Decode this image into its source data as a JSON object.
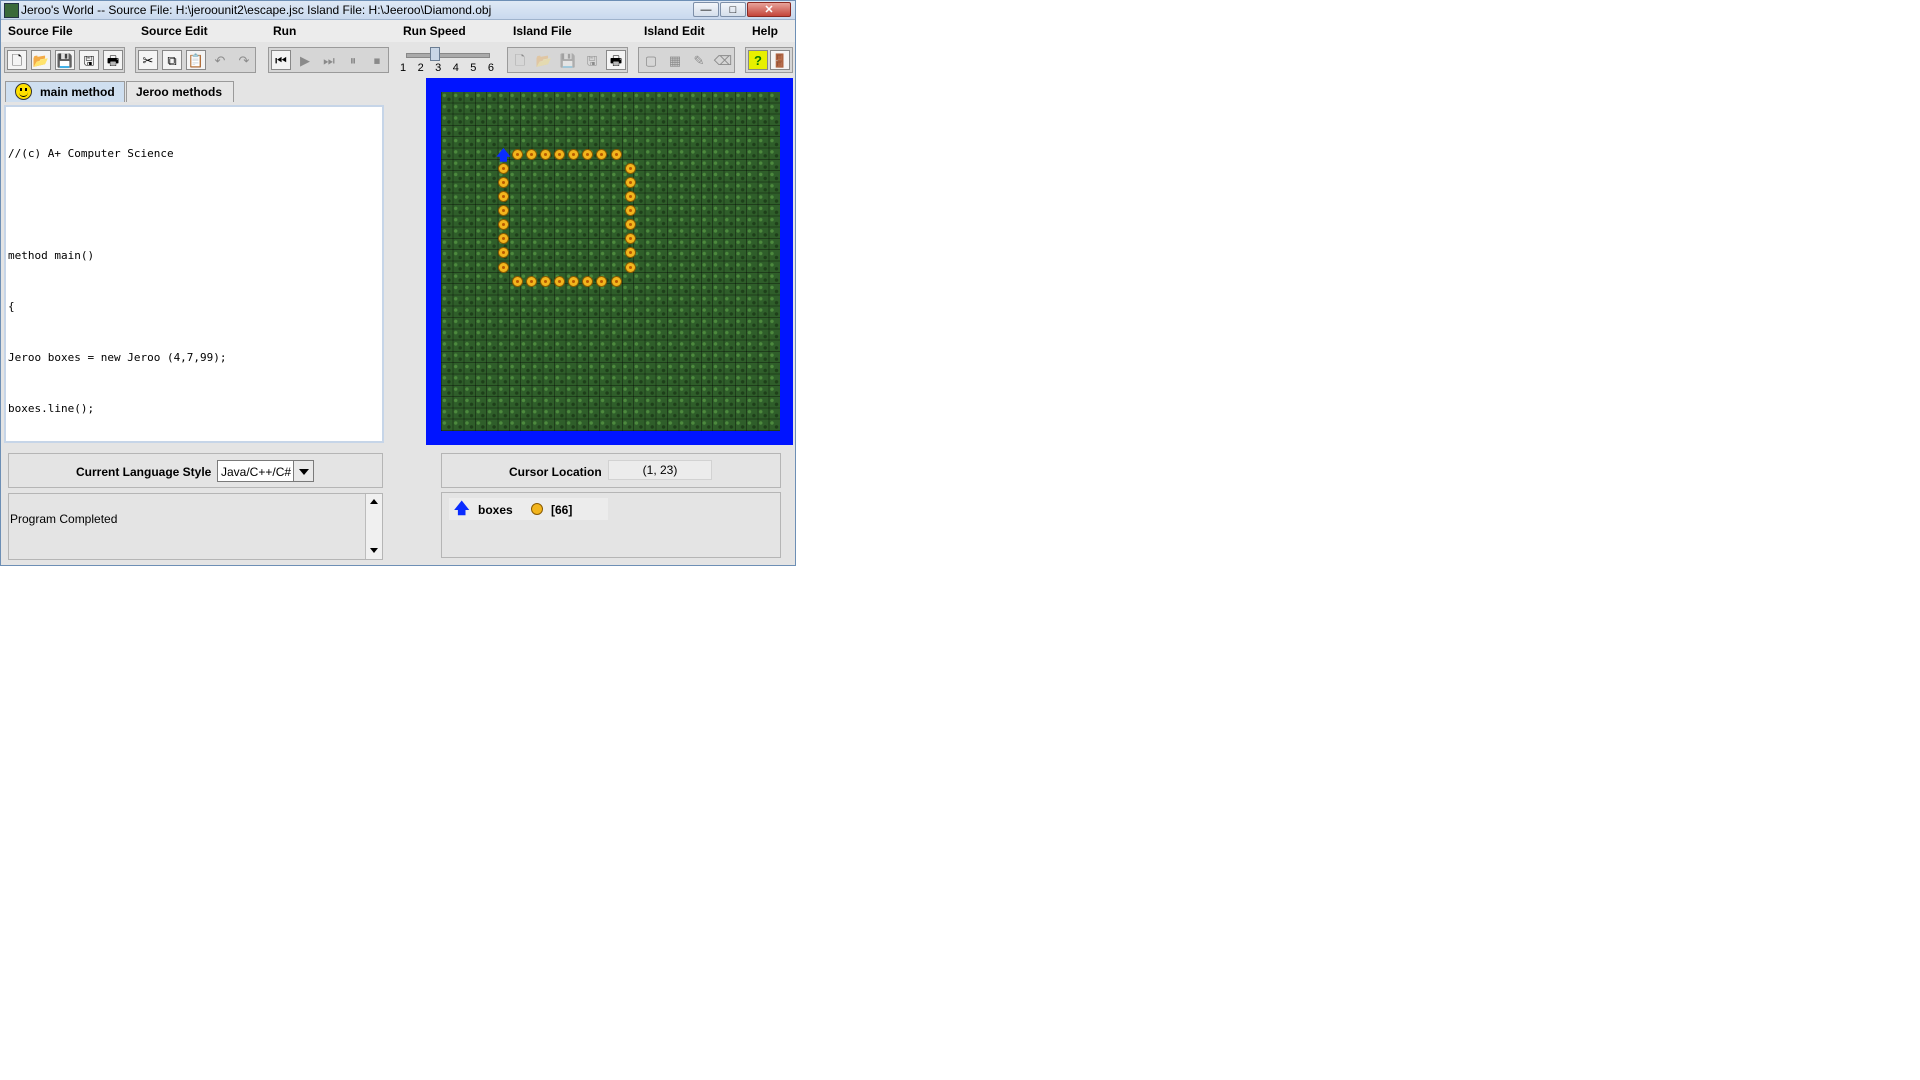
{
  "window": {
    "title": "Jeroo's World -- Source File: H:\\jeroounit2\\escape.jsc    Island File: H:\\Jeeroo\\Diamond.obj",
    "controls": {
      "minimize": "—",
      "maximize": "□",
      "close": "✕"
    }
  },
  "menubar": [
    "Source File",
    "Source Edit",
    "Run",
    "Run Speed",
    "Island File",
    "Island Edit",
    "Help"
  ],
  "toolbar": {
    "source_buttons": [
      "new-file-icon",
      "open-file-icon",
      "save-icon",
      "save-as-icon",
      "print-icon"
    ],
    "edit_buttons": [
      "cut-icon",
      "copy-icon",
      "paste-icon",
      "undo-icon",
      "redo-icon"
    ],
    "run_buttons": [
      "reset-icon",
      "run-icon",
      "step-icon",
      "pause-icon",
      "stop-icon"
    ],
    "island_buttons": [
      "new-island-icon",
      "open-island-icon",
      "save-island-icon",
      "save-island-as-icon",
      "print-island-icon"
    ],
    "island_edit_buttons": [
      "clear-island-icon",
      "grid-icon",
      "edit-icon",
      "erase-icon"
    ],
    "help_buttons": [
      "help-icon",
      "exit-icon"
    ],
    "run_speed": {
      "labels": [
        "1",
        "2",
        "3",
        "4",
        "5",
        "6"
      ],
      "value": 3
    }
  },
  "tabs": [
    {
      "label": "main method",
      "active": true
    },
    {
      "label": "Jeroo methods",
      "active": false
    }
  ],
  "editor": {
    "lines": [
      "//(c) A+ Computer Science",
      "",
      "method main()",
      "{",
      "Jeroo boxes = new Jeroo (4,7,99);",
      "boxes.line();",
      "}"
    ],
    "highlight_line": 7
  },
  "language": {
    "label": "Current Language Style",
    "value": "Java/C++/C#"
  },
  "status": {
    "message": "Program Completed"
  },
  "cursor": {
    "label": "Cursor Location",
    "value": "(1, 23)"
  },
  "jeroo": {
    "name": "boxes",
    "flowers": "[66]",
    "direction": "north"
  },
  "island": {
    "cols": 24,
    "rows": 24,
    "jeroo_cell": [
      4,
      4
    ],
    "flowers_top": {
      "row": 4,
      "cols": [
        5,
        6,
        7,
        8,
        9,
        10,
        11,
        12
      ]
    },
    "flowers_left": {
      "col": 4,
      "rows": [
        5,
        6,
        7,
        8,
        9,
        10,
        11,
        12
      ]
    },
    "flowers_right": {
      "col": 13,
      "rows": [
        5,
        6,
        7,
        8,
        9,
        10,
        11,
        12
      ]
    },
    "flowers_bottom": {
      "row": 13,
      "cols": [
        5,
        6,
        7,
        8,
        9,
        10,
        11,
        12
      ]
    },
    "colors": {
      "water": "#0014ff",
      "grass": "#2f5e2a",
      "flower": "#f2b51d",
      "jeroo": "#0a2cff"
    }
  }
}
